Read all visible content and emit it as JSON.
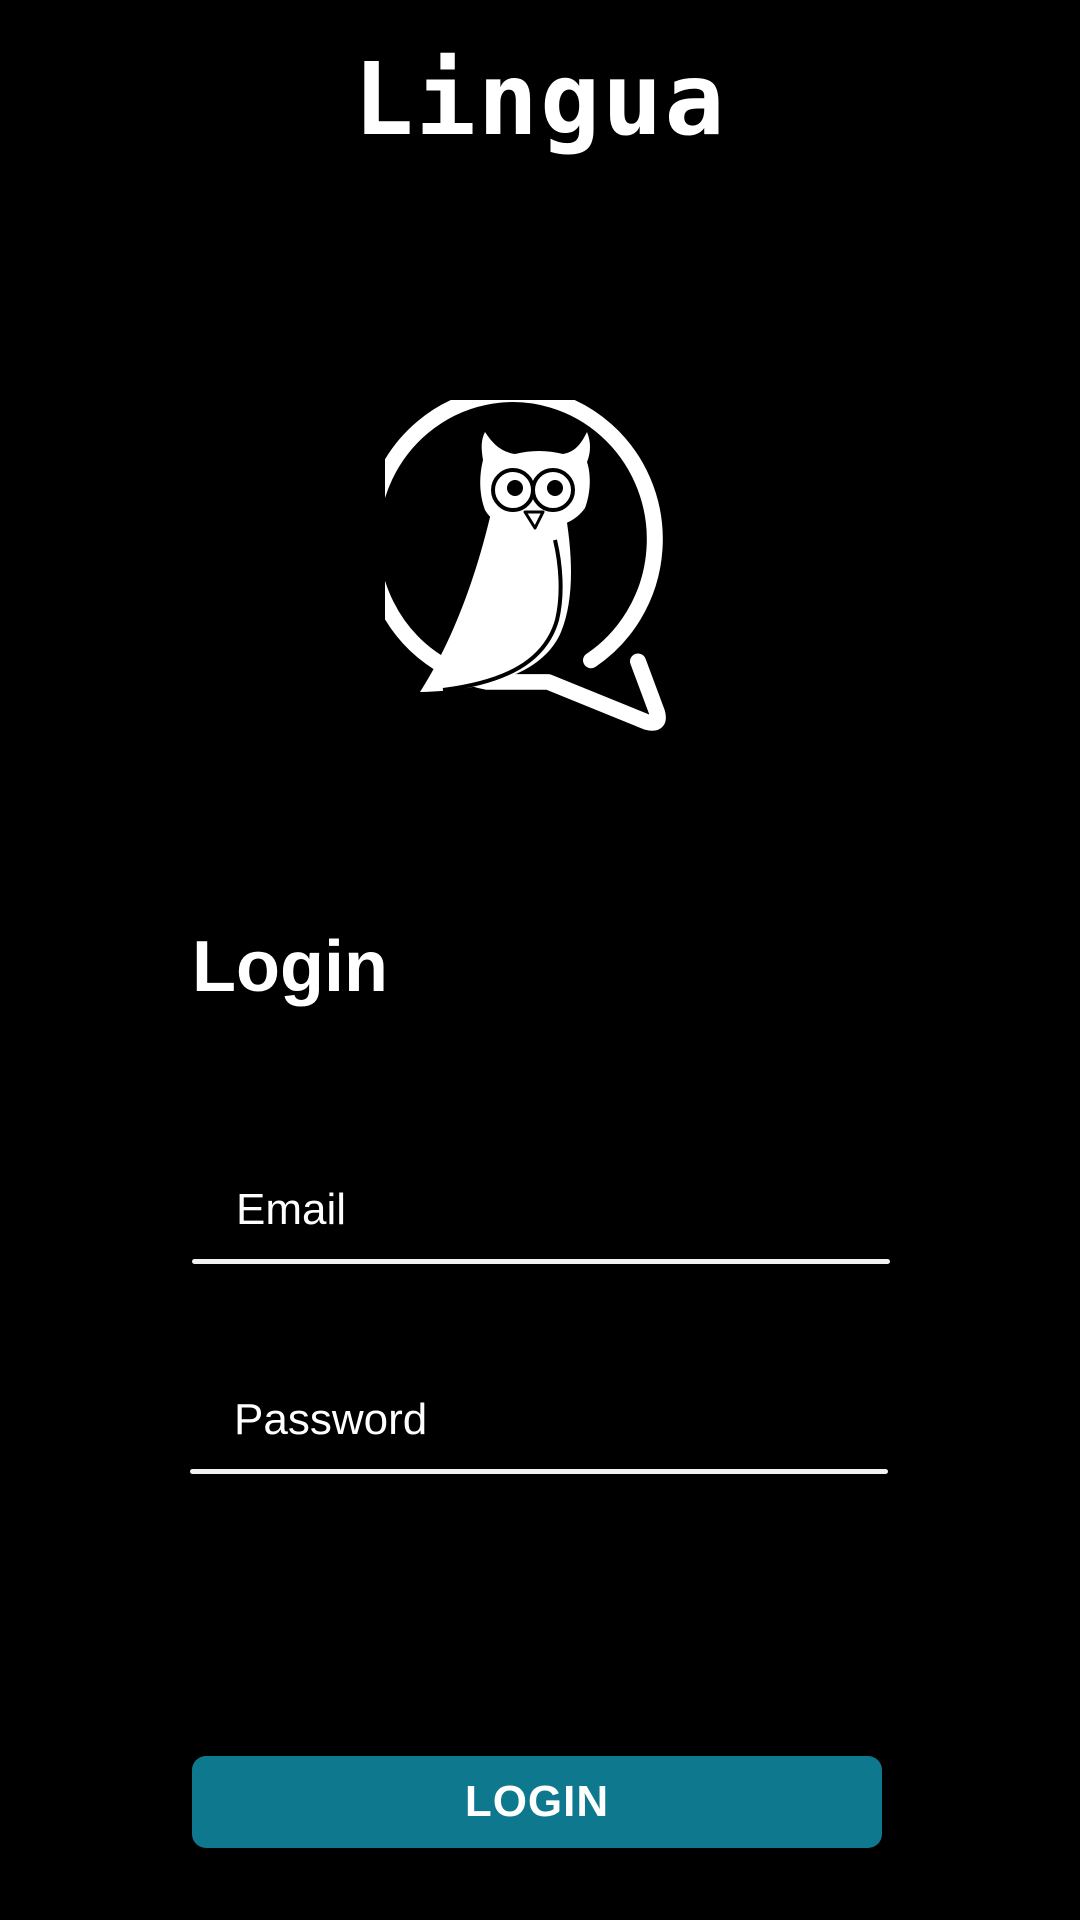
{
  "app": {
    "title": "Lingua"
  },
  "logo": {
    "icon": "owl-speech-bubble-icon"
  },
  "login": {
    "heading": "Login",
    "email": {
      "placeholder": "Email",
      "value": ""
    },
    "password": {
      "placeholder": "Password",
      "value": ""
    },
    "button_label": "LOGIN"
  },
  "colors": {
    "background": "#000000",
    "text": "#ffffff",
    "accent": "#0e788e",
    "underline": "#f2f2f2"
  }
}
